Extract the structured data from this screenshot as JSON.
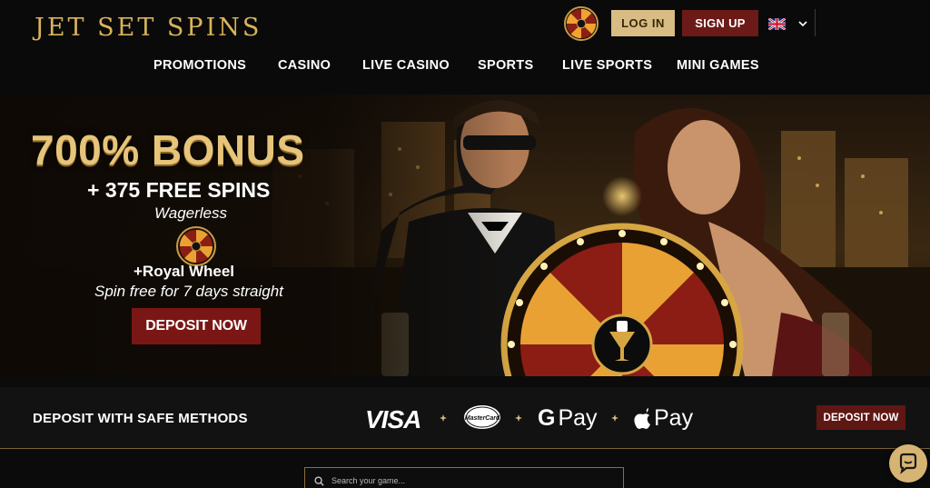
{
  "header": {
    "logo_text": "JET SET SPINS",
    "login_label": "LOG IN",
    "signup_label": "SIGN UP"
  },
  "nav": {
    "items": [
      "PROMOTIONS",
      "CASINO",
      "LIVE CASINO",
      "SPORTS",
      "LIVE SPORTS",
      "MINI GAMES"
    ]
  },
  "hero": {
    "title": "700% BONUS",
    "subtitle": "+ 375 FREE SPINS",
    "wagerless": "Wagerless",
    "royal_wheel": "+Royal Wheel",
    "spin_free": "Spin free for 7 days straight",
    "deposit_label": "DEPOSIT NOW"
  },
  "payments": {
    "title": "DEPOSIT WITH SAFE METHODS",
    "visa": "VISA",
    "mastercard": "MasterCard",
    "gpay": "Pay",
    "applepay": "Pay",
    "deposit_label": "DEPOSIT NOW"
  },
  "search": {
    "placeholder": "Search your game..."
  },
  "colors": {
    "gold": "#d7bd84",
    "dark_red": "#6b1a17",
    "background": "#0b0b0b"
  },
  "icons": {
    "wheel": "fortune-wheel-icon",
    "flag": "uk-flag-icon",
    "chevron": "chevron-down-icon",
    "search": "search-icon",
    "chat": "chat-icon",
    "apple": "apple-icon"
  }
}
